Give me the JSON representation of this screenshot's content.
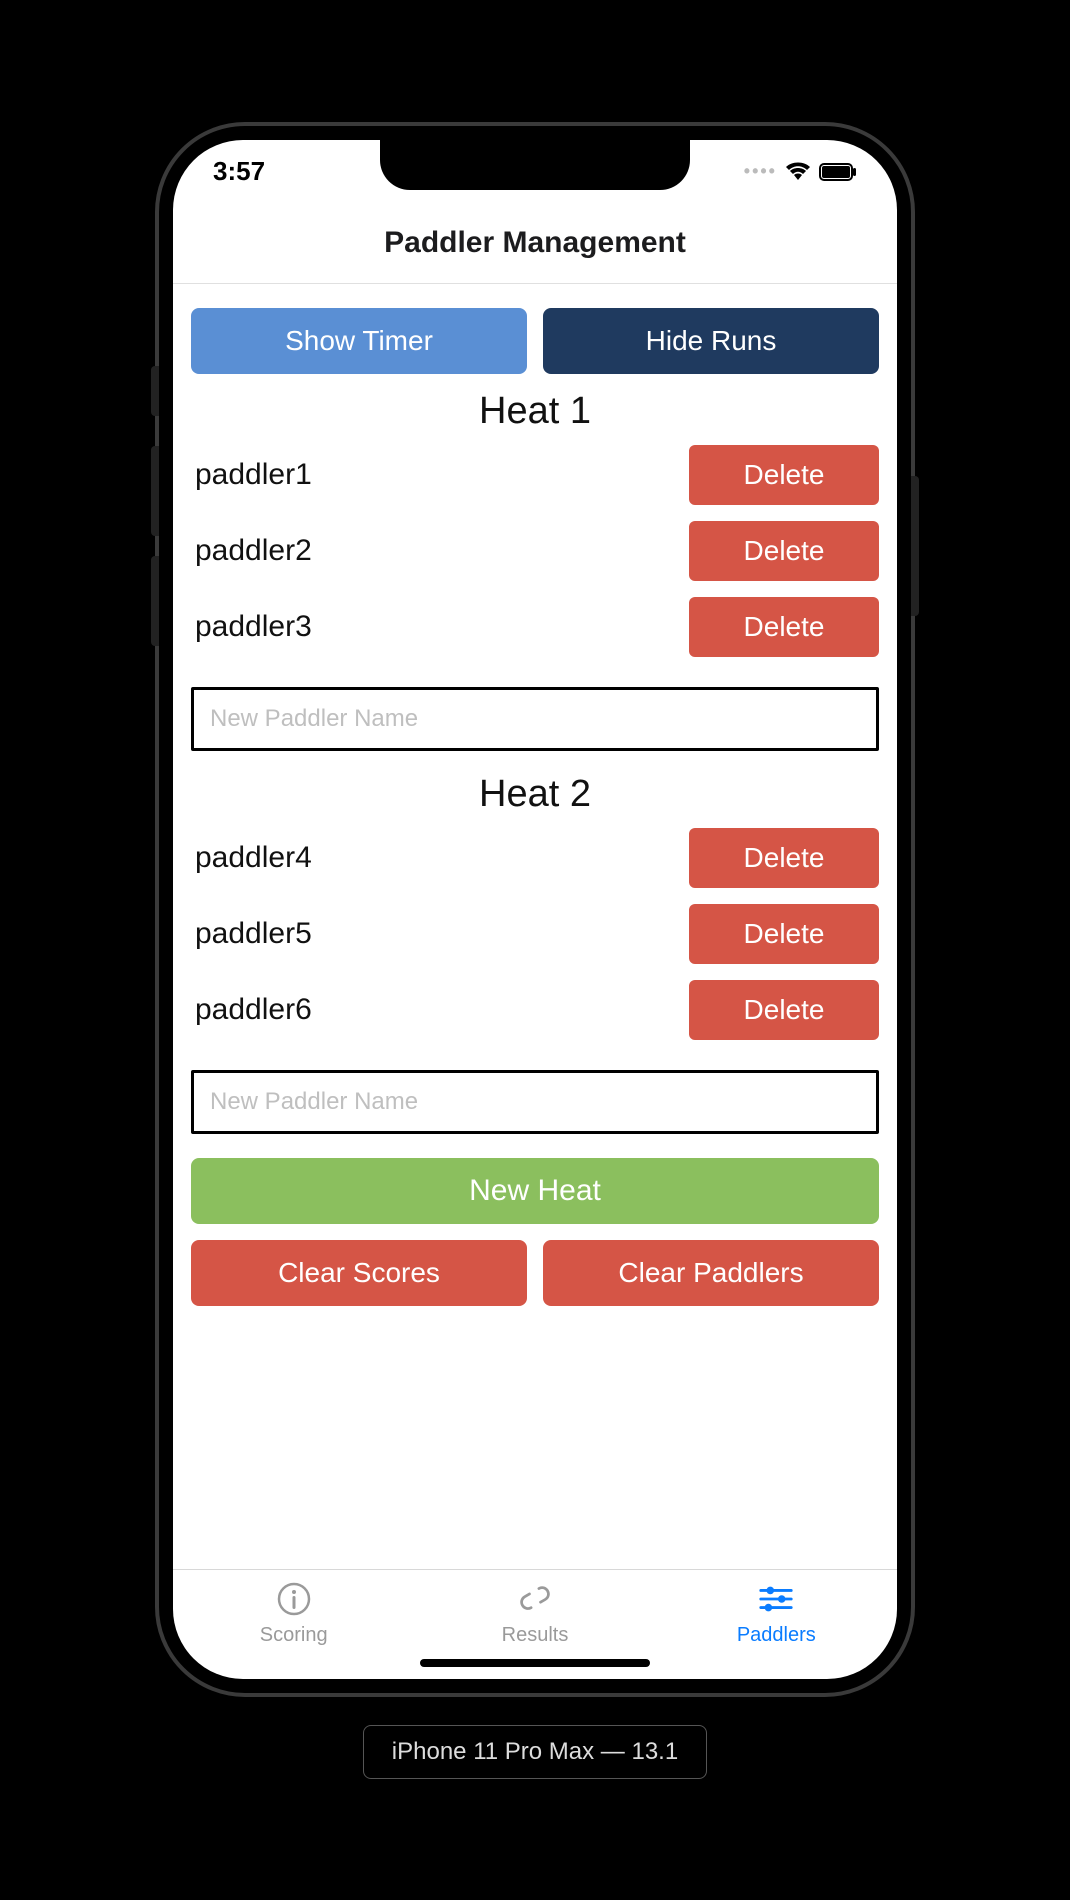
{
  "status": {
    "time": "3:57"
  },
  "nav": {
    "title": "Paddler Management"
  },
  "top_buttons": {
    "show_timer": "Show Timer",
    "hide_runs": "Hide Runs"
  },
  "heats": [
    {
      "title": "Heat 1",
      "paddlers": [
        {
          "name": "paddler1",
          "delete": "Delete"
        },
        {
          "name": "paddler2",
          "delete": "Delete"
        },
        {
          "name": "paddler3",
          "delete": "Delete"
        }
      ],
      "placeholder": "New Paddler Name"
    },
    {
      "title": "Heat 2",
      "paddlers": [
        {
          "name": "paddler4",
          "delete": "Delete"
        },
        {
          "name": "paddler5",
          "delete": "Delete"
        },
        {
          "name": "paddler6",
          "delete": "Delete"
        }
      ],
      "placeholder": "New Paddler Name"
    }
  ],
  "actions": {
    "new_heat": "New Heat",
    "clear_scores": "Clear Scores",
    "clear_paddlers": "Clear Paddlers"
  },
  "tabs": {
    "scoring": "Scoring",
    "results": "Results",
    "paddlers": "Paddlers"
  },
  "device_label": "iPhone 11 Pro Max — 13.1"
}
